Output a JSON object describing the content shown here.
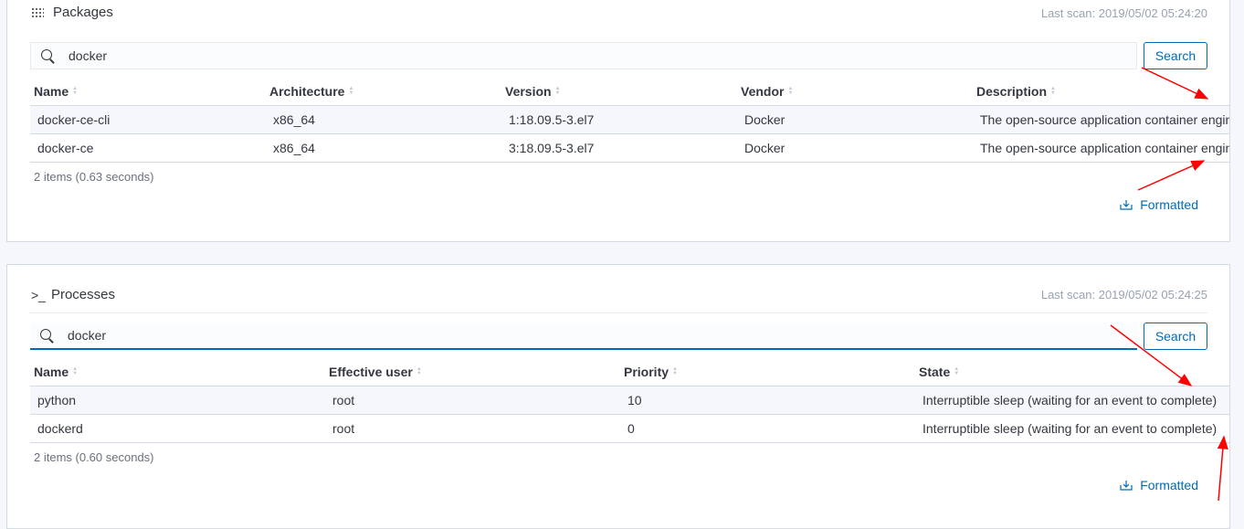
{
  "packages": {
    "title": "Packages",
    "icon": "grid-icon",
    "last_scan": "Last scan: 2019/05/02 05:24:20",
    "search_value": "docker",
    "search_label": "Search",
    "columns": [
      "Name",
      "Architecture",
      "Version",
      "Vendor",
      "Description"
    ],
    "rows": [
      [
        "docker-ce-cli",
        "x86_64",
        "1:18.09.5-3.el7",
        "Docker",
        "The open-source application container engine"
      ],
      [
        "docker-ce",
        "x86_64",
        "3:18.09.5-3.el7",
        "Docker",
        "The open-source application container engine"
      ]
    ],
    "items_count": "2 items (0.63 seconds)",
    "formatted_label": "Formatted"
  },
  "processes": {
    "title": "Processes",
    "icon": "terminal-icon",
    "icon_text": ">_",
    "last_scan": "Last scan: 2019/05/02 05:24:25",
    "search_value": "docker",
    "search_label": "Search",
    "columns": [
      "Name",
      "Effective user",
      "Priority",
      "State"
    ],
    "rows": [
      [
        "python",
        "root",
        "10",
        "Interruptible sleep (waiting for an event to complete)"
      ],
      [
        "dockerd",
        "root",
        "0",
        "Interruptible sleep (waiting for an event to complete)"
      ]
    ],
    "items_count": "2 items (0.60 seconds)",
    "formatted_label": "Formatted"
  },
  "colors": {
    "accent": "#006bb4",
    "annotation": "#ff0000"
  }
}
